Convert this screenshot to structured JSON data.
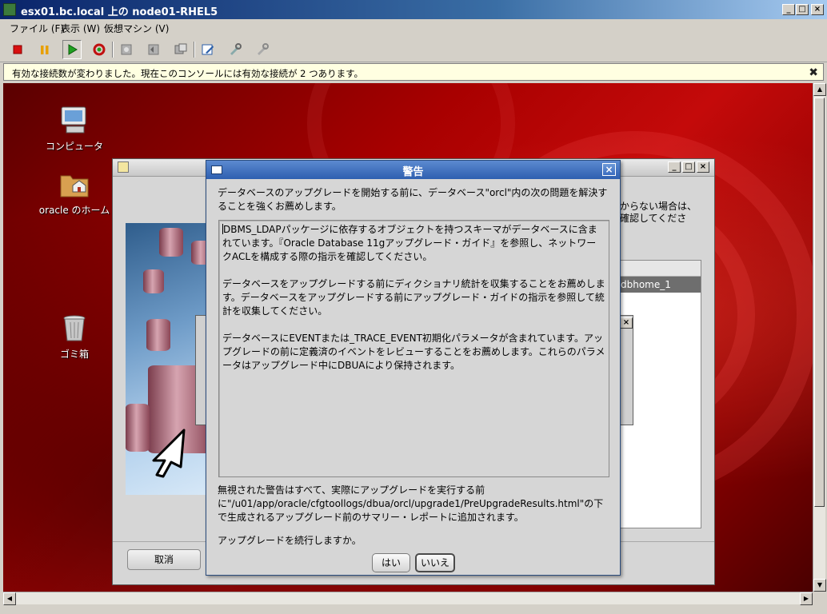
{
  "window": {
    "title": "esx01.bc.local 上の node01-RHEL5",
    "controls": {
      "minimize": "_",
      "maximize": "□",
      "close": "×"
    }
  },
  "menubar": {
    "items": [
      "ファイル (F)",
      "表示 (W)",
      "仮想マシン (V)"
    ]
  },
  "toolbar": {
    "buttons": [
      "stop-icon",
      "pause-icon",
      "play-icon",
      "reset-icon",
      "snapshot-icon",
      "revert-snapshot-icon",
      "manage-snapshots-icon",
      "edit-settings-icon",
      "vmware-tools-icon",
      "migrate-icon"
    ],
    "colors": {
      "stop": "#d81010",
      "pause": "#e8a000",
      "play": "#20a020"
    }
  },
  "notice": {
    "text": "有効な接続数が変わりました。現在このコンソールには有効な接続が 2 つあります。",
    "close": "✖"
  },
  "desktop": {
    "icons": [
      {
        "label": "コンピュータ",
        "icon": "computer-icon"
      },
      {
        "label": "oracle のホーム",
        "icon": "home-folder-icon"
      },
      {
        "label": "ゴミ箱",
        "icon": "trash-icon"
      }
    ]
  },
  "dbua": {
    "peek_right_1": "からない場合は、",
    "peek_right_2": "確認してくださ",
    "list_row": "dbhome_1",
    "cancel_label": "取消"
  },
  "warning_dialog": {
    "title": "警告",
    "intro": "データベースのアップグレードを開始する前に、データベース\"orcl\"内の次の問題を解決することを強くお薦めします。",
    "messages": [
      "DBMS_LDAPパッケージに依存するオブジェクトを持つスキーマがデータベースに含まれています。『Oracle Database 11gアップグレード・ガイド』を参照し、ネットワークACLを構成する際の指示を確認してください。",
      "データベースをアップグレードする前にディクショナリ統計を収集することをお薦めします。データベースをアップグレードする前にアップグレード・ガイドの指示を参照して統計を収集してください。",
      "データベースにEVENTまたは_TRACE_EVENT初期化パラメータが含まれています。アップグレードの前に定義済のイベントをレビューすることをお薦めします。これらのパラメータはアップグレード中にDBUAにより保持されます。"
    ],
    "footer": "無視された警告はすべて、実際にアップグレードを実行する前に\"/u01/app/oracle/cfgtoollogs/dbua/orcl/upgrade1/PreUpgradeResults.html\"の下で生成されるアップグレード前のサマリー・レポートに追加されます。",
    "question": "アップグレードを続行しますか。",
    "yes_label": "はい",
    "no_label": "いいえ"
  }
}
